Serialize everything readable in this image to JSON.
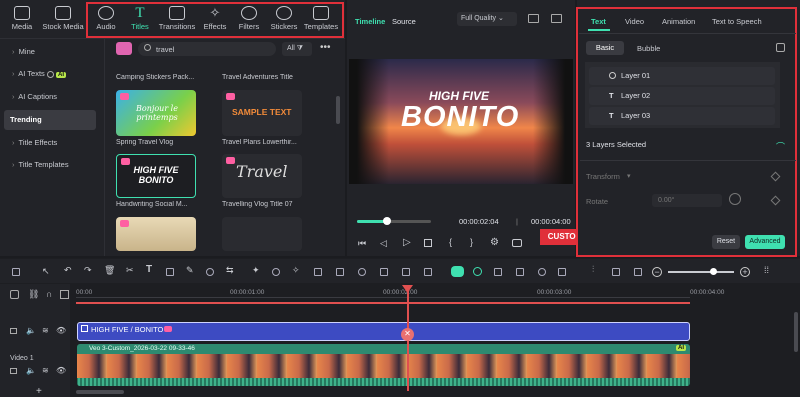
{
  "topnav": {
    "media": "Media",
    "stock_media": "Stock Media",
    "audio": "Audio",
    "titles": "Titles",
    "transitions": "Transitions",
    "effects": "Effects",
    "filters": "Filters",
    "stickers": "Stickers",
    "templates": "Templates"
  },
  "sidebar": {
    "items": [
      {
        "label": "Mine"
      },
      {
        "label": "AI Texts",
        "badge": "AI"
      },
      {
        "label": "AI Captions"
      },
      {
        "label": "Trending"
      },
      {
        "label": "Title Effects"
      },
      {
        "label": "Title Templates"
      }
    ]
  },
  "search": {
    "value": "travel",
    "filter_label": "All"
  },
  "library": {
    "items": [
      {
        "label": "Camping Stickers Pack..."
      },
      {
        "label": "Travel Adventures Title"
      },
      {
        "label": "Spring Travel Vlog",
        "thumb_text": "Bonjour le printemps"
      },
      {
        "label": "Travel Plans Lowerthir...",
        "thumb_text": "SAMPLE TEXT"
      },
      {
        "label": "Handwriting Social M...",
        "thumb_text": "HIGH FIVE BONITO"
      },
      {
        "label": "Travelling Vlog Title 07",
        "thumb_text": "Travel"
      }
    ]
  },
  "player": {
    "tab_timeline": "Timeline",
    "tab_source": "Source",
    "quality": "Full Quality",
    "overlay_line1": "HIGH FIVE",
    "overlay_line2": "BONITO",
    "current_time": "00:00:02:04",
    "total_time": "00:00:04:00",
    "progress_fraction": 0.4
  },
  "inspector": {
    "tabs": [
      "Text",
      "Video",
      "Animation",
      "Text to Speech"
    ],
    "subtabs": [
      "Basic",
      "Bubble"
    ],
    "layers": [
      "Layer 01",
      "Layer 02",
      "Layer 03"
    ],
    "selected_text": "3 Layers Selected",
    "transform_label": "Transform",
    "rotate_label": "Rotate",
    "rotate_value": "0.00°",
    "reset": "Reset",
    "advanced": "Advanced"
  },
  "callout": "CUSTOMIZE HERE",
  "timeline": {
    "ruler": [
      "00:00",
      "00:00:01:00",
      "00:00:02:00",
      "00:00:03:00",
      "00:00:04:00"
    ],
    "title_clip": "HIGH FIVE / BONITO",
    "video_clip": "Veo 3-Custom_2026-03-22 09-33-46",
    "video_track_label": "Video 1",
    "ai_badge": "AI"
  },
  "colors": {
    "accent": "#3fe0b0",
    "highlight": "#e0303a",
    "title_clip": "#3d4bc2",
    "video_clip": "#2e8a70"
  }
}
